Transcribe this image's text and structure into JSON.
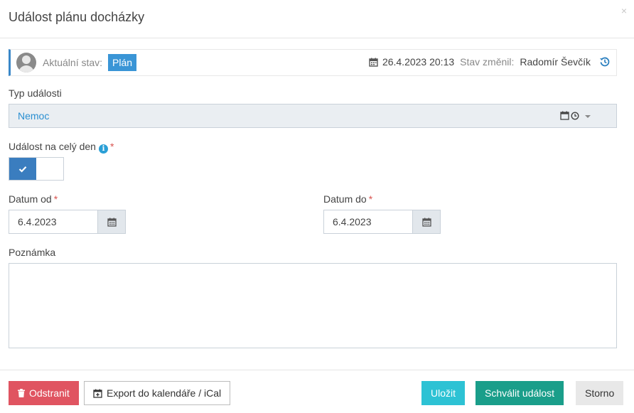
{
  "modal": {
    "title": "Událost plánu docházky",
    "close": "×"
  },
  "state": {
    "label": "Aktuální stav:",
    "badge": "Plán",
    "date": "26.4.2023 20:13",
    "changed_label": "Stav změnil:",
    "changed_by": "Radomír Ševčík"
  },
  "form": {
    "event_type": {
      "label": "Typ události",
      "value": "Nemoc"
    },
    "all_day": {
      "label": "Událost na celý den",
      "required": "*",
      "checked": true
    },
    "date_from": {
      "label": "Datum od",
      "required": "*",
      "value": "6.4.2023"
    },
    "date_to": {
      "label": "Datum do",
      "required": "*",
      "value": "6.4.2023"
    },
    "note": {
      "label": "Poznámka",
      "value": ""
    }
  },
  "footer": {
    "delete_label": "Odstranit",
    "export_label": "Export do kalendáře / iCal",
    "save_label": "Uložit",
    "approve_label": "Schválit událost",
    "cancel_label": "Storno"
  },
  "colors": {
    "accent": "#3a95d6",
    "danger": "#e05461",
    "save": "#2dc2d4",
    "approve": "#1a9e8a"
  },
  "icons": [
    "user-avatar-icon",
    "calendar-icon",
    "history-icon",
    "clock-icon",
    "info-icon",
    "check-icon",
    "trash-icon",
    "calendar-plus-icon",
    "close-icon"
  ]
}
